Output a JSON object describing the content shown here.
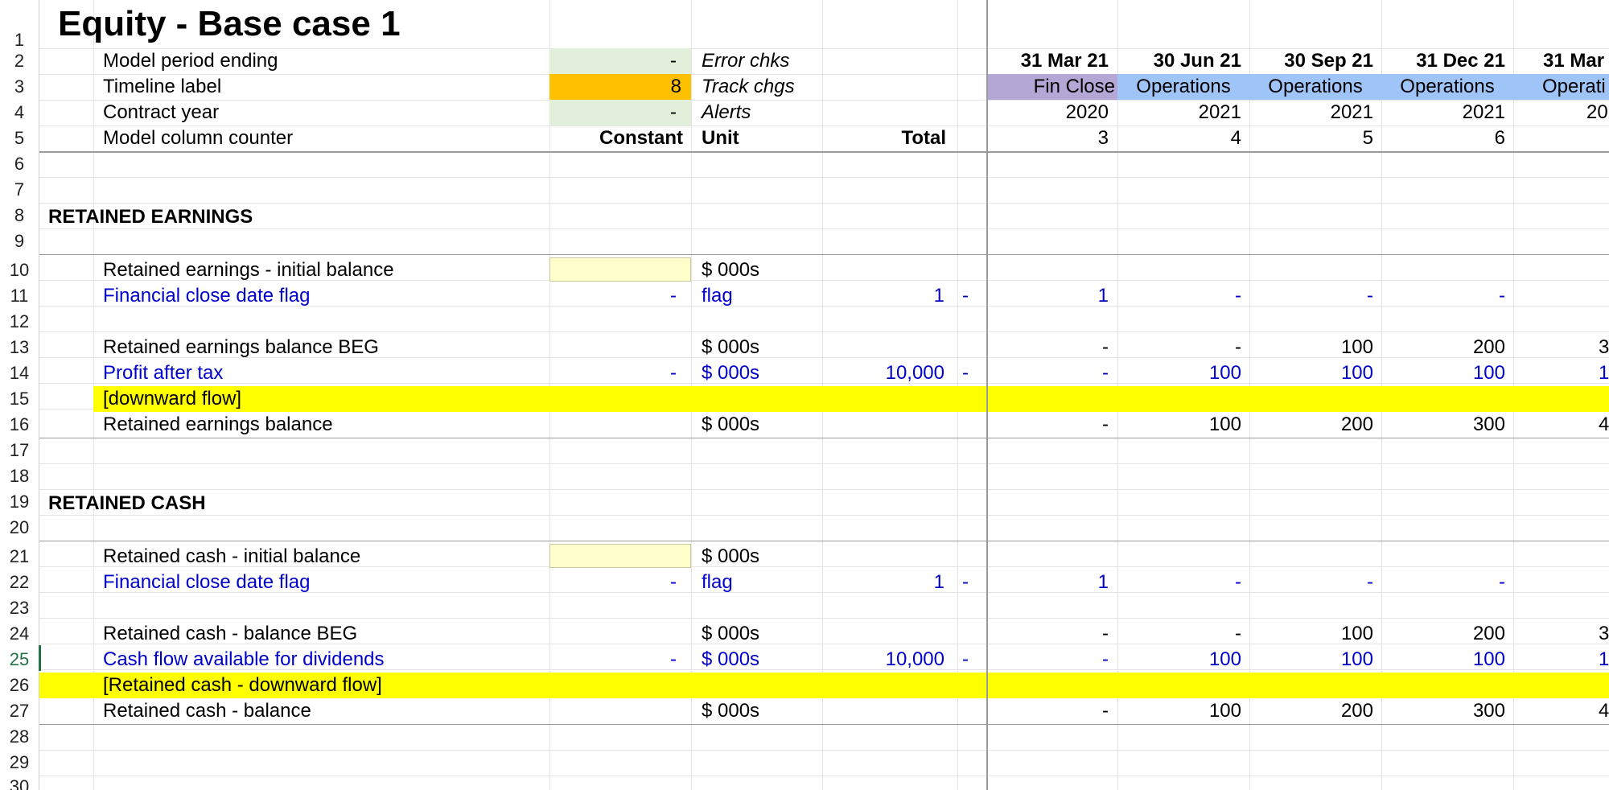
{
  "title": "Equity - Base case 1",
  "row_numbers": [
    "1",
    "2",
    "3",
    "4",
    "5",
    "6",
    "7",
    "8",
    "9",
    "10",
    "11",
    "12",
    "13",
    "14",
    "15",
    "16",
    "17",
    "18",
    "19",
    "20",
    "21",
    "22",
    "23",
    "24",
    "25",
    "26",
    "27",
    "28",
    "29",
    "30"
  ],
  "header": {
    "model_period_ending": {
      "label": "Model period ending",
      "value": "-"
    },
    "timeline_label": {
      "label": "Timeline label",
      "value": "8"
    },
    "contract_year": {
      "label": "Contract year",
      "value": "-"
    },
    "model_column_counter": {
      "label": "Model column counter"
    },
    "error_chks": "Error chks",
    "track_chgs": "Track chgs",
    "alerts": "Alerts",
    "constant": "Constant",
    "unit": "Unit",
    "total": "Total"
  },
  "timeline": [
    {
      "date": "31 Mar 21",
      "phase": "Fin Close",
      "year": "2020",
      "counter": "3"
    },
    {
      "date": "30 Jun 21",
      "phase": "Operations",
      "year": "2021",
      "counter": "4"
    },
    {
      "date": "30 Sep 21",
      "phase": "Operations",
      "year": "2021",
      "counter": "5"
    },
    {
      "date": "31 Dec 21",
      "phase": "Operations",
      "year": "2021",
      "counter": "6"
    },
    {
      "date": "31 Mar",
      "phase": "Operati",
      "year": "20",
      "counter": ""
    }
  ],
  "sections": {
    "retained_earnings": {
      "heading": "RETAINED EARNINGS",
      "initial_balance": {
        "label": "Retained earnings - initial balance",
        "unit": "$ 000s"
      },
      "flag": {
        "label": "Financial close date flag",
        "constant": "-",
        "unit": "flag",
        "total": "1",
        "dash": "-",
        "values": [
          "1",
          "-",
          "-",
          "-"
        ]
      },
      "balance_beg": {
        "label": "Retained earnings balance BEG",
        "unit": "$ 000s",
        "values": [
          "-",
          "-",
          "100",
          "200",
          "3"
        ]
      },
      "profit": {
        "label": "Profit after tax",
        "constant": "-",
        "unit": "$ 000s",
        "total": "10,000",
        "dash": "-",
        "values": [
          "-",
          "100",
          "100",
          "100",
          "1"
        ]
      },
      "flow": "[downward flow]",
      "balance": {
        "label": "Retained earnings balance",
        "unit": "$ 000s",
        "values": [
          "-",
          "100",
          "200",
          "300",
          "4"
        ]
      }
    },
    "retained_cash": {
      "heading": "RETAINED CASH",
      "initial_balance": {
        "label": "Retained cash - initial balance",
        "unit": "$ 000s"
      },
      "flag": {
        "label": "Financial close date flag",
        "constant": "-",
        "unit": "flag",
        "total": "1",
        "dash": "-",
        "values": [
          "1",
          "-",
          "-",
          "-"
        ]
      },
      "balance_beg": {
        "label": "Retained cash - balance BEG",
        "unit": "$ 000s",
        "values": [
          "-",
          "-",
          "100",
          "200",
          "3"
        ]
      },
      "cfads": {
        "label": "Cash flow available for dividends",
        "constant": "-",
        "unit": "$ 000s",
        "total": "10,000",
        "dash": "-",
        "values": [
          "-",
          "100",
          "100",
          "100",
          "1"
        ]
      },
      "flow": "[Retained cash - downward flow]",
      "balance": {
        "label": "Retained cash - balance",
        "unit": "$ 000s",
        "values": [
          "-",
          "100",
          "200",
          "300",
          "4"
        ]
      }
    }
  },
  "colors": {
    "green_input": "#e2efda",
    "orange_input": "#ffc000",
    "yellow_input": "#ffffcc",
    "flow_yellow": "#ffff00",
    "fin_close": "#b4a7d6",
    "operations": "#9fc5f8",
    "blue_text": "#0000cc"
  }
}
